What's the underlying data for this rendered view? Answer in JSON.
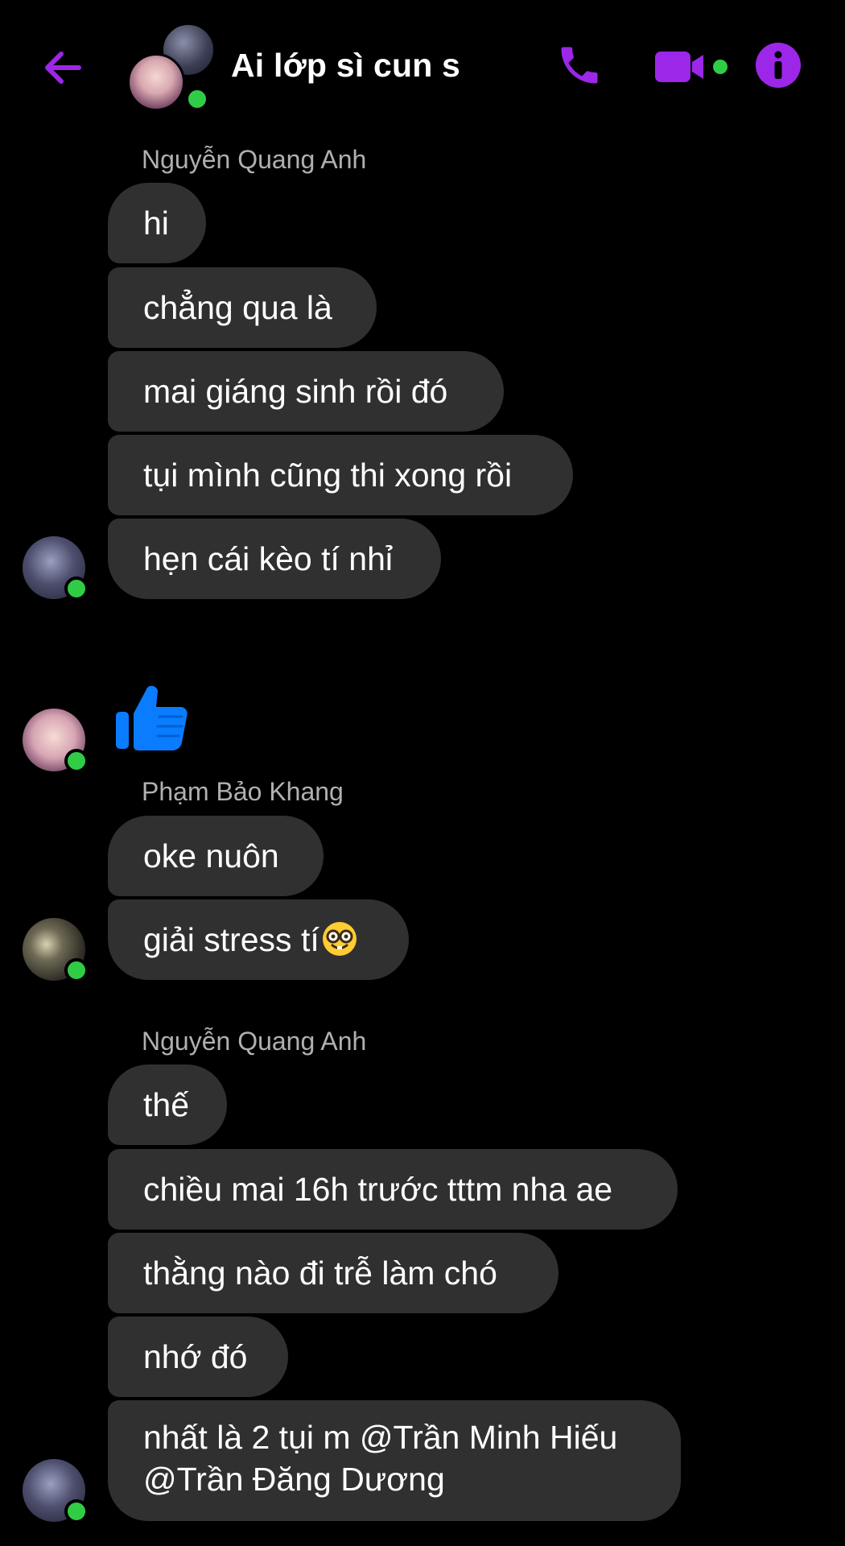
{
  "header": {
    "title": "Ai lớp sì cun s",
    "back_icon": "back-arrow-icon",
    "call_icon": "phone-icon",
    "video_icon": "video-camera-icon",
    "info_icon": "info-icon",
    "accent_color": "#9c27e8",
    "online_color": "#31cc46"
  },
  "messages": [
    {
      "sender": "Nguyễn Quang Anh",
      "texts": [
        "hi",
        "chẳng qua là",
        "mai giáng sinh rồi đó",
        "tụi mình cũng thi xong rồi",
        "hẹn cái kèo tí nhỉ"
      ]
    },
    {
      "sender_hidden": true,
      "sticker": "thumbs-up-icon"
    },
    {
      "sender": "Phạm Bảo Khang",
      "texts": [
        "oke nuôn",
        "giải stress tí"
      ],
      "emoji": "nerd-face-icon"
    },
    {
      "sender": "Nguyễn Quang Anh",
      "texts": [
        "thế",
        "chiều mai 16h trước tttm nha ae",
        "thằng nào đi trễ làm chó",
        "nhớ đó"
      ],
      "multiline": {
        "line1": "nhất là 2 tụi m @Trần Minh Hiếu",
        "line2": "@Trần Đăng Dương"
      }
    }
  ],
  "colors": {
    "bubble_bg": "#303030",
    "sender_name": "#b0b0b0",
    "thumb": "#0a7cff"
  }
}
